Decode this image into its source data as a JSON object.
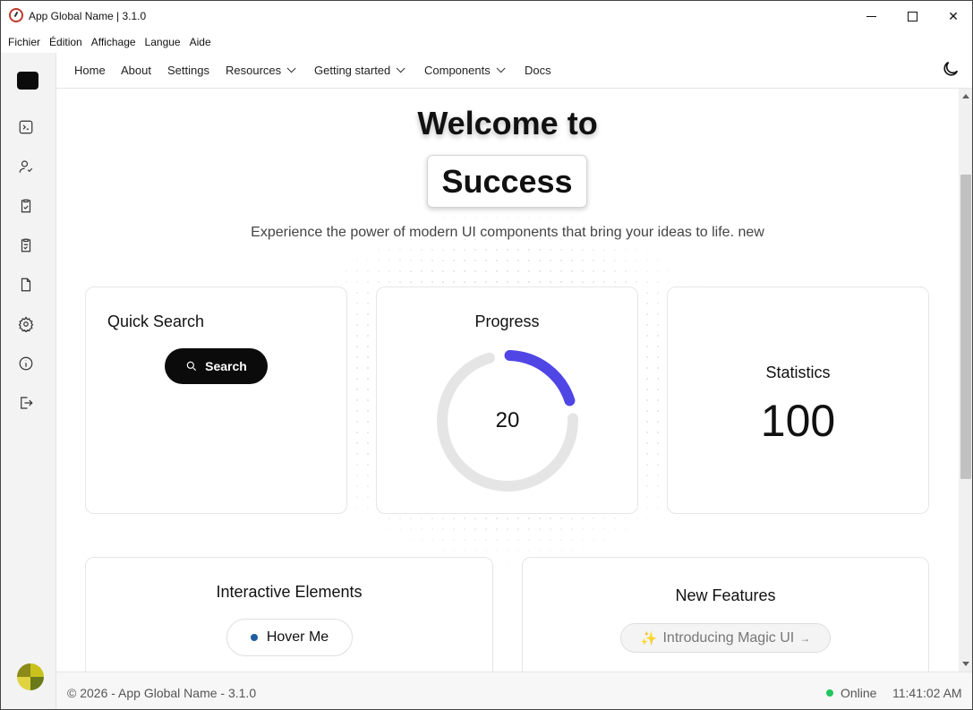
{
  "window": {
    "title": "App Global Name | 3.1.0"
  },
  "menubar": [
    "Fichier",
    "Édition",
    "Affichage",
    "Langue",
    "Aide"
  ],
  "sidebar": {
    "icons": [
      "terminal-icon",
      "user-check-icon",
      "clipboard-check-icon",
      "clipboard-list-icon",
      "file-icon",
      "settings-icon",
      "info-icon",
      "logout-icon"
    ]
  },
  "nav": {
    "items": [
      {
        "label": "Home",
        "dropdown": false
      },
      {
        "label": "About",
        "dropdown": false
      },
      {
        "label": "Settings",
        "dropdown": false
      },
      {
        "label": "Resources",
        "dropdown": true
      },
      {
        "label": "Getting started",
        "dropdown": true
      },
      {
        "label": "Components",
        "dropdown": true
      },
      {
        "label": "Docs",
        "dropdown": false
      }
    ],
    "theme_icon": "moon-icon"
  },
  "hero": {
    "title": "Welcome to",
    "highlight": "Success",
    "subtitle": "Experience the power of modern UI components that bring your ideas to life. new"
  },
  "cards": {
    "search": {
      "title": "Quick Search",
      "button": "Search"
    },
    "progress": {
      "title": "Progress",
      "value": "20",
      "percent": 20,
      "color": "#4f46e5",
      "track_color": "#e5e5e5"
    },
    "stats": {
      "title": "Statistics",
      "value": "100"
    },
    "interactive": {
      "title": "Interactive Elements",
      "button": "Hover Me"
    },
    "features": {
      "title": "New Features",
      "pill": "Introducing Magic UI"
    }
  },
  "footer": {
    "copyright": "© 2026 - App Global Name - 3.1.0",
    "status": "Online",
    "status_color": "#22c55e",
    "time": "11:41:02 AM"
  }
}
